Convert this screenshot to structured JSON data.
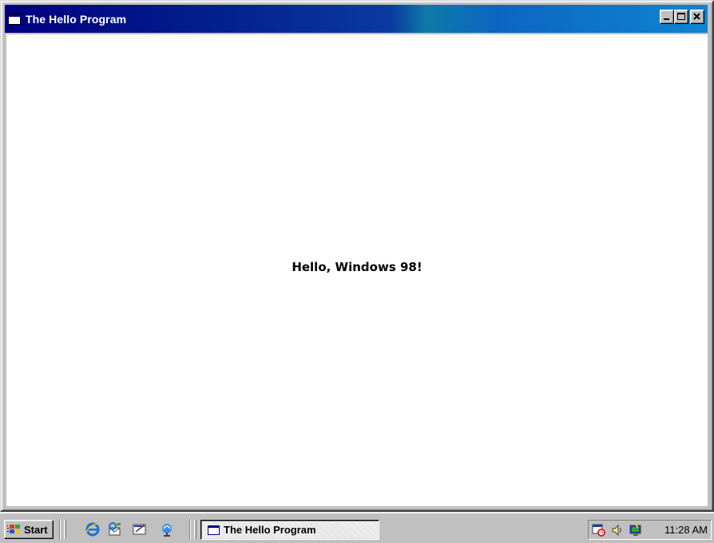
{
  "window": {
    "title": "The Hello Program",
    "title_icon": "window-icon",
    "controls": [
      "minimize-icon",
      "maximize-icon",
      "close-icon"
    ],
    "message": "Hello, Windows 98!"
  },
  "taskbar": {
    "start_label": "Start",
    "quick_launch": [
      "internet-explorer-icon",
      "outlook-express-icon",
      "show-desktop-icon",
      "channels-icon"
    ],
    "tasks": [
      {
        "label": "The Hello Program",
        "icon": "window-icon"
      }
    ],
    "tray": {
      "icons": [
        "scheduler-icon",
        "volume-icon",
        "monitor-icon"
      ],
      "clock": "11:28 AM"
    }
  },
  "colors": {
    "desktop": "#008080",
    "title_active": "#000080",
    "title_gradient_end": "#1084d0",
    "face": "#c0c0c0"
  }
}
